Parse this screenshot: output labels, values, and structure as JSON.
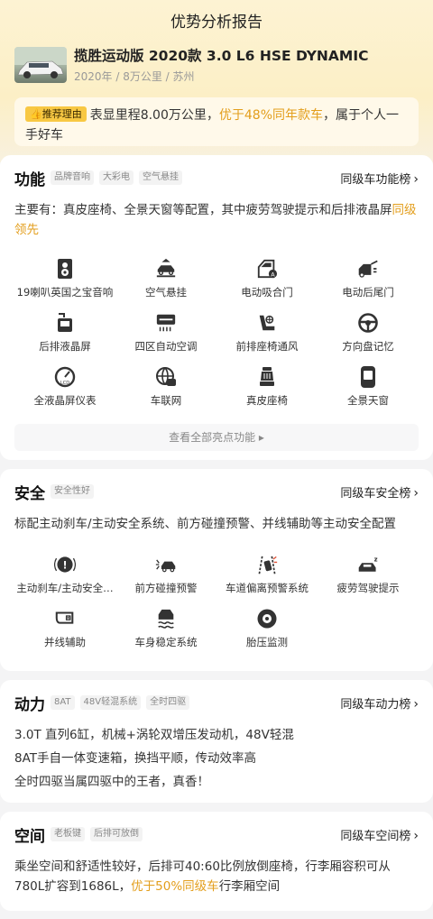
{
  "header": {
    "title": "优势分析报告"
  },
  "car": {
    "name": "揽胜运动版 2020款 3.0 L6 HSE DYNAMIC",
    "meta": "2020年 / 8万公里 / 苏州"
  },
  "reason": {
    "badge": "推荐理由",
    "text_a": "表显里程8.00万公里，",
    "highlight": "优于48%同年款车",
    "text_b": "，属于个人一手好车"
  },
  "function": {
    "title": "功能",
    "tags": [
      "品牌音响",
      "大彩电",
      "空气悬挂"
    ],
    "rank": "同级车功能榜",
    "desc_a": "主要有：真皮座椅、全景天窗等配置，其中疲劳驾驶提示和后排液晶屏",
    "desc_hl": "同级领先",
    "items": [
      {
        "label": "19喇叭英国之宝音响",
        "icon": "speaker-icon"
      },
      {
        "label": "空气悬挂",
        "icon": "air-suspension-icon"
      },
      {
        "label": "电动吸合门",
        "icon": "power-door-icon"
      },
      {
        "label": "电动后尾门",
        "icon": "power-tailgate-icon"
      },
      {
        "label": "后排液晶屏",
        "icon": "rear-screen-icon"
      },
      {
        "label": "四区自动空调",
        "icon": "ac-icon"
      },
      {
        "label": "前排座椅通风",
        "icon": "seat-vent-icon"
      },
      {
        "label": "方向盘记忆",
        "icon": "steering-wheel-icon"
      },
      {
        "label": "全液晶屏仪表",
        "icon": "lcd-gauge-icon"
      },
      {
        "label": "车联网",
        "icon": "connected-car-icon"
      },
      {
        "label": "真皮座椅",
        "icon": "leather-seat-icon"
      },
      {
        "label": "全景天窗",
        "icon": "sunroof-icon"
      }
    ],
    "view_all": "查看全部亮点功能 ▸"
  },
  "safety": {
    "title": "安全",
    "tags": [
      "安全性好"
    ],
    "rank": "同级车安全榜",
    "desc": "标配主动刹车/主动安全系统、前方碰撞预警、并线辅助等主动安全配置",
    "items": [
      {
        "label": "主动刹车/主动安全…",
        "icon": "brake-icon"
      },
      {
        "label": "前方碰撞预警",
        "icon": "collision-warning-icon"
      },
      {
        "label": "车道偏离预警系统",
        "icon": "lane-departure-icon"
      },
      {
        "label": "疲劳驾驶提示",
        "icon": "fatigue-icon"
      },
      {
        "label": "并线辅助",
        "icon": "blind-spot-icon"
      },
      {
        "label": "车身稳定系统",
        "icon": "stability-icon"
      },
      {
        "label": "胎压监测",
        "icon": "tire-pressure-icon"
      }
    ]
  },
  "power": {
    "title": "动力",
    "tags": [
      "8AT",
      "48V轻混系统",
      "全时四驱"
    ],
    "rank": "同级车动力榜",
    "lines": [
      "3.0T 直列6缸，机械+涡轮双增压发动机，48V轻混",
      "8AT手自一体变速箱，换挡平顺，传动效率高",
      "全时四驱当属四驱中的王者，真香！"
    ]
  },
  "space": {
    "title": "空间",
    "tags": [
      "老板键",
      "后排可放倒"
    ],
    "rank": "同级车空间榜",
    "desc_a": "乘坐空间和舒适性较好，后排可40:60比例放倒座椅，行李厢容积可从780L扩容到1686L，",
    "desc_hl": "优于50%同级车",
    "desc_b": "行李厢空间"
  },
  "colors": {
    "accent": "#e39e1c",
    "badge": "#f8c843",
    "icon": "#333333"
  }
}
